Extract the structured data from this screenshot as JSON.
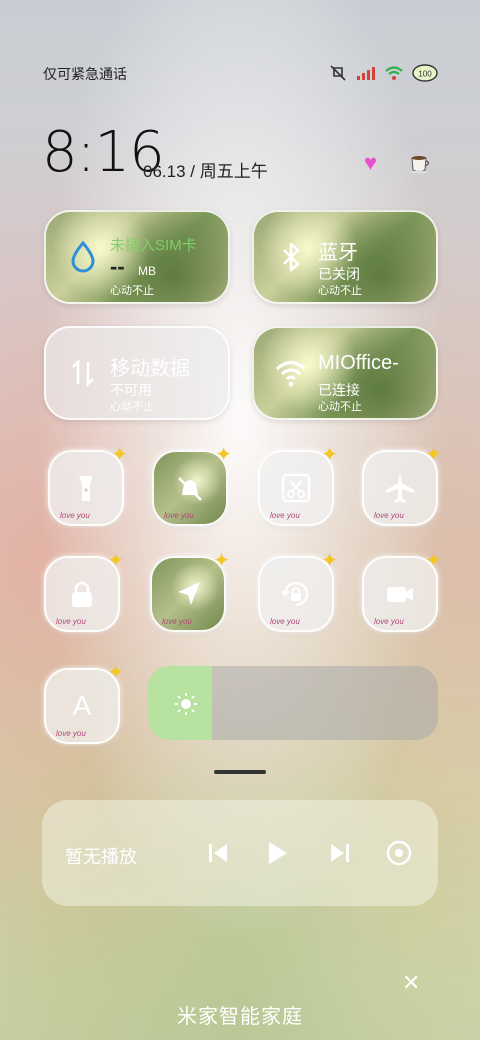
{
  "status_bar": {
    "carrier_text": "仅可紧急通话"
  },
  "lock": {
    "time": "8:16",
    "date": "06.13 / 周五上午"
  },
  "tiles": {
    "sim": {
      "title": "未插入SIM卡",
      "value": "--",
      "unit": "MB",
      "note": "心动不止"
    },
    "bluetooth": {
      "title": "蓝牙",
      "status": "已关闭",
      "note": "心动不止"
    },
    "mobile_data": {
      "title": "移动数据",
      "status": "不可用",
      "note": "心动不止"
    },
    "wifi": {
      "title": "MIOffice-",
      "status": "已连接",
      "note": "心动不止"
    }
  },
  "round_buttons": {
    "love_text": "love you",
    "items": [
      "flashlight",
      "mute",
      "screenshot",
      "airplane-mode",
      "screen-lock",
      "location",
      "rotation-lock",
      "screen-record",
      "auto-brightness"
    ],
    "auto_brightness_letter": "A"
  },
  "brightness": {
    "level": 0.22
  },
  "media": {
    "label": "暂无播放"
  },
  "footer": {
    "title": "米家智能家庭"
  },
  "colors": {
    "accent_green": "#b8e29f",
    "wifi_green": "#2db34a",
    "sim_blue": "#2f8fd8"
  }
}
